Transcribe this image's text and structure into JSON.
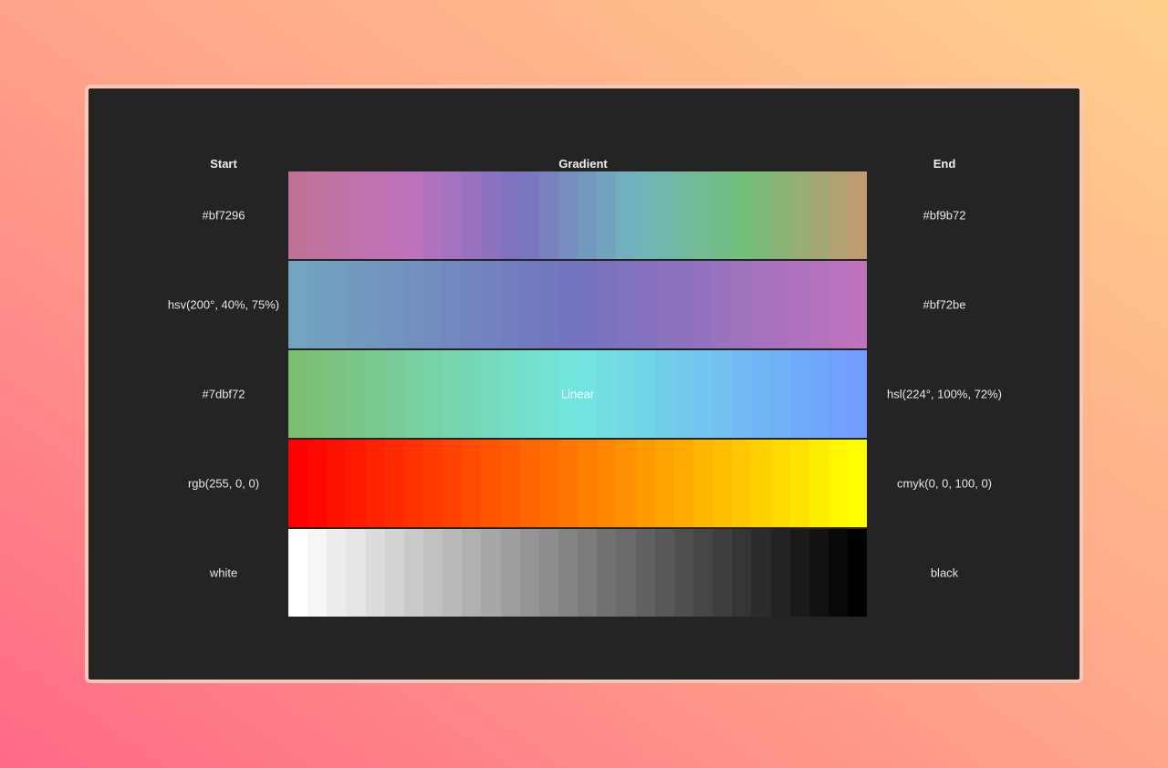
{
  "headers": {
    "start": "Start",
    "gradient": "Gradient",
    "end": "End"
  },
  "rows": [
    {
      "start": "#bf7296",
      "end": "#bf9b72",
      "label": "",
      "stops": [
        "#bf7296",
        "#bf72be",
        "#7872bf",
        "#72b4bf",
        "#72bf78",
        "#bf9b72"
      ]
    },
    {
      "start": "hsv(200°, 40%, 75%)",
      "end": "#bf72be",
      "label": "",
      "stops": [
        "#72a5bf",
        "#7272bf",
        "#bf72be"
      ]
    },
    {
      "start": "#7dbf72",
      "end": "hsl(224°, 100%, 72%)",
      "label": "Linear",
      "stops": [
        "#7dbf72",
        "#72e6e0",
        "#709dff"
      ]
    },
    {
      "start": "rgb(255, 0, 0)",
      "end": "cmyk(0, 0, 100, 0)",
      "label": "",
      "stops": [
        "#ff0000",
        "#ff7a00",
        "#ffff00"
      ]
    },
    {
      "start": "white",
      "end": "black",
      "label": "",
      "stops": [
        "#ffffff",
        "#000000"
      ]
    }
  ]
}
